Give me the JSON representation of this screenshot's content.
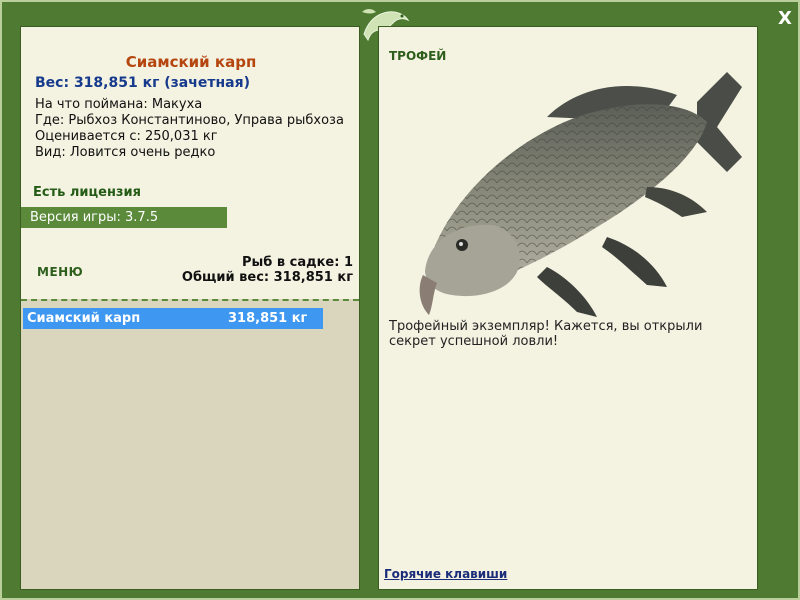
{
  "fish": {
    "name": "Сиамский карп",
    "weight_line": "Вес: 318,851 кг (зачетная)",
    "caught_on": "На что поймана: Макуха",
    "where": "Где: Рыбхоз Константиново, Управа рыбхоза",
    "value": "Оценивается с: 250,031 кг",
    "rarity": "Вид: Ловится очень редко"
  },
  "license": "Есть лицензия",
  "version": "Версия игры: 3.7.5",
  "menu_label": "МЕНЮ",
  "keepnet": {
    "count": "Рыб в садке: 1",
    "total": "Общий вес: 318,851 кг"
  },
  "list": [
    {
      "name": "Сиамский карп",
      "weight": "318,851 кг"
    }
  ],
  "trophy": {
    "label": "ТРОФЕЙ",
    "description": "Трофейный экземпляр! Кажется, вы открыли секрет успешной ловли!"
  },
  "hotkeys_link": "Горячие клавиши",
  "close_label": "X",
  "colors": {
    "frame": "#4f7a31",
    "panel": "#f4f2e1",
    "selection": "#3e97f0",
    "title": "#b5460f",
    "weight": "#163a8c"
  },
  "icons": [
    "lizard-logo-icon",
    "close-icon",
    "fish-image"
  ]
}
